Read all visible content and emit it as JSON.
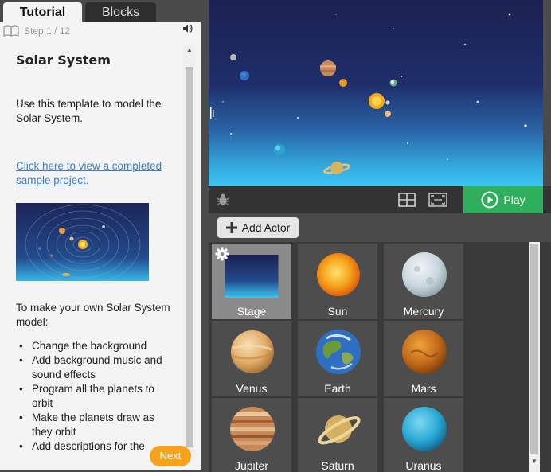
{
  "tabs": {
    "tutorial": "Tutorial",
    "blocks": "Blocks"
  },
  "tutorial": {
    "step": "Step 1 / 12",
    "title": "Solar System",
    "intro": "Use this template to model the Solar System.",
    "link": "Click here to view a completed sample project.",
    "body": "To make your own Solar System model:",
    "bullets": [
      "Change the background",
      "Add background music and sound effects",
      "Program all the planets to orbit",
      "Make the planets draw as they orbit",
      "Add descriptions for the"
    ],
    "next": "Next"
  },
  "stagebar": {
    "play": "Play"
  },
  "actors_panel": {
    "add_actor": "Add Actor",
    "actors": [
      {
        "label": "Stage",
        "icon": "stage-thumbnail",
        "selected": true
      },
      {
        "label": "Sun",
        "icon": "sun"
      },
      {
        "label": "Mercury",
        "icon": "mercury"
      },
      {
        "label": "Venus",
        "icon": "venus"
      },
      {
        "label": "Earth",
        "icon": "earth"
      },
      {
        "label": "Mars",
        "icon": "mars"
      },
      {
        "label": "Jupiter",
        "icon": "jupiter"
      },
      {
        "label": "Saturn",
        "icon": "saturn"
      },
      {
        "label": "Uranus",
        "icon": "uranus"
      }
    ]
  },
  "colors": {
    "play": "#2fae5b",
    "next": "#f7a21b",
    "link": "#3b7cc8",
    "sun": "#f4a81c",
    "uranus": "#29a9d6"
  }
}
